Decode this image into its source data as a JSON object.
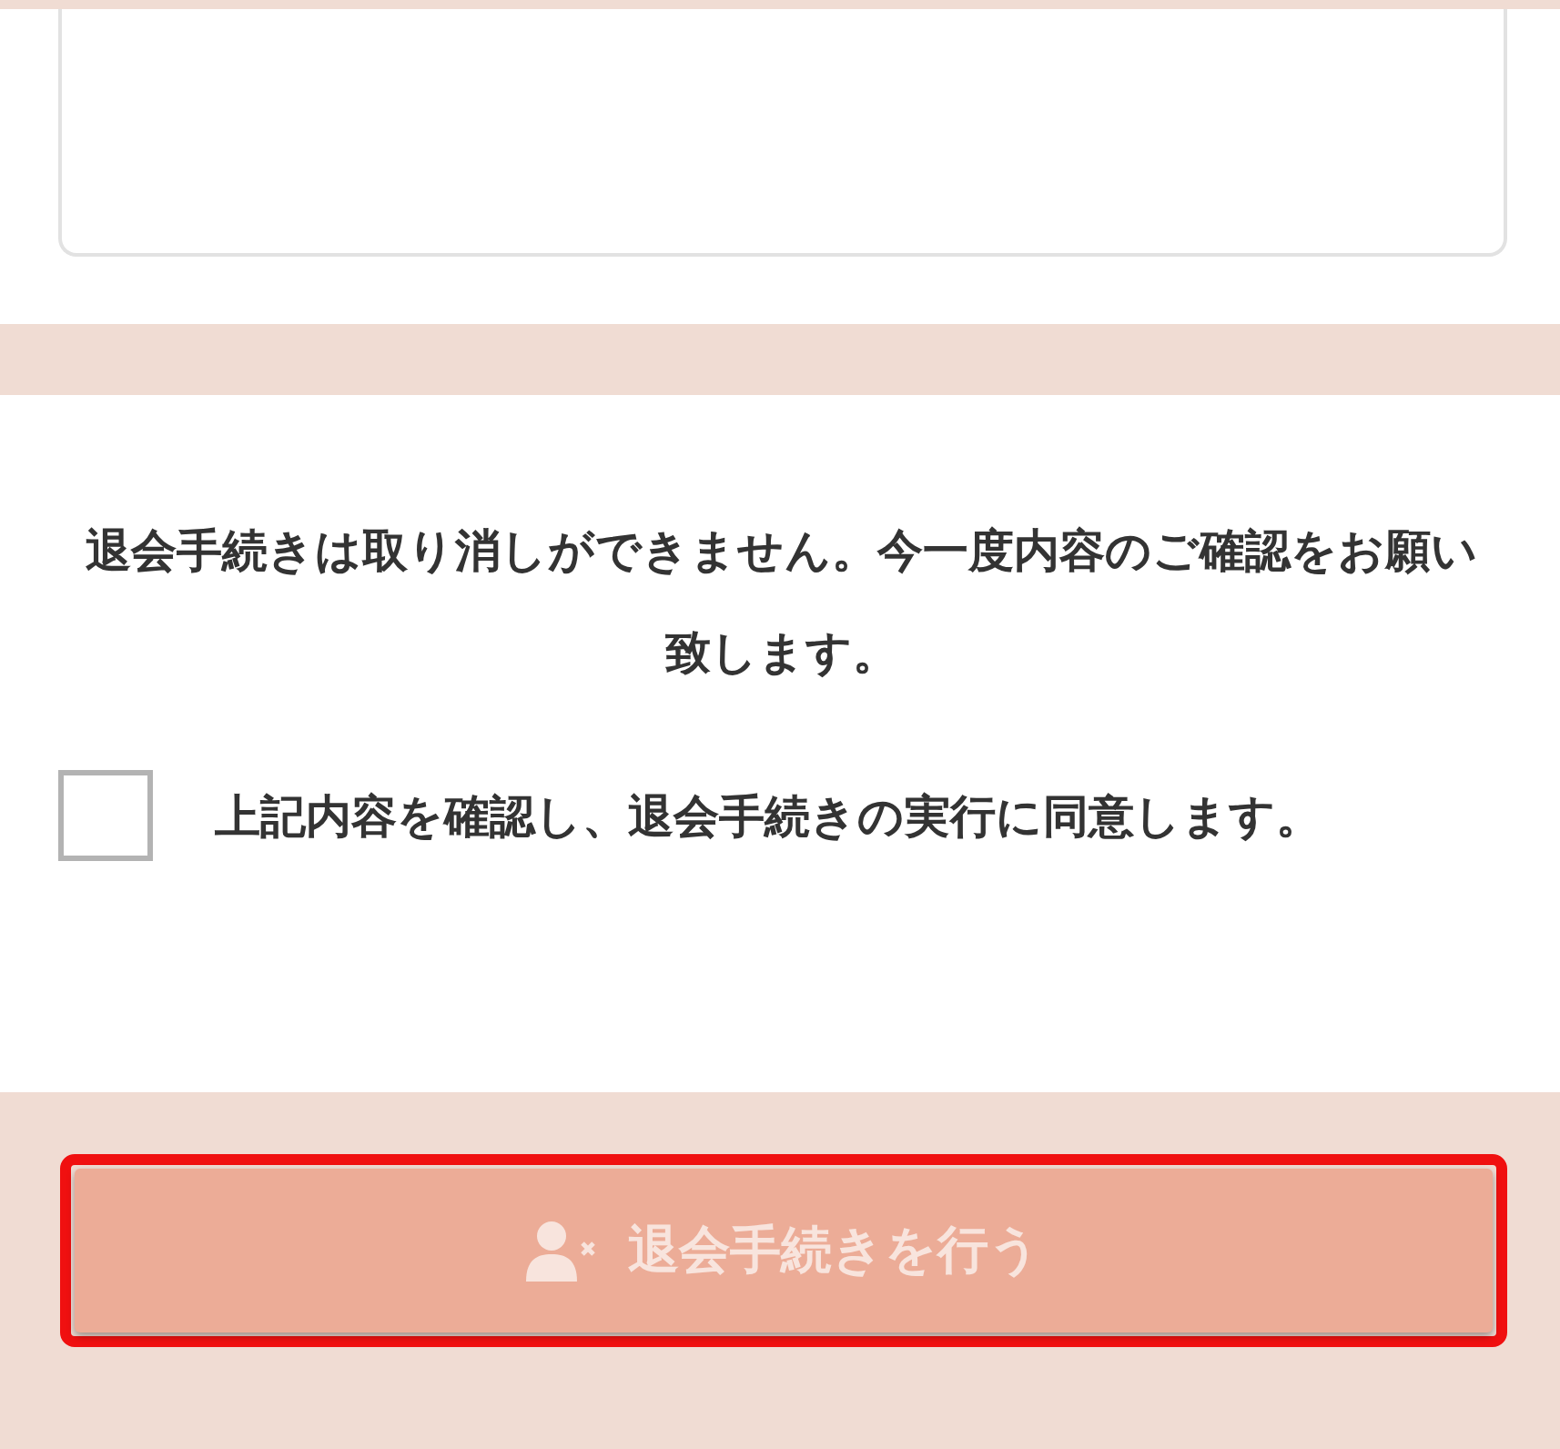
{
  "notice": "退会手続きは取り消しができません。今一度内容のご確認をお願い致します。",
  "agreement": {
    "label": "上記内容を確認し、退会手続きの実行に同意します。",
    "checked": false
  },
  "submit_button": {
    "label": "退会手続きを行う",
    "disabled": true,
    "highlighted": true
  }
}
